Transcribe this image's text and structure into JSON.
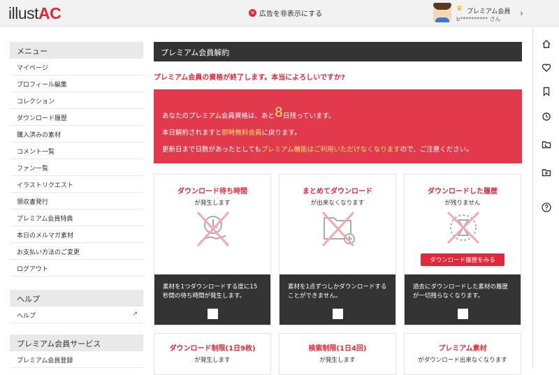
{
  "header": {
    "logo_part1": "illust",
    "logo_part2": "AC",
    "hide_ads": "広告を非表示にする",
    "user_label": "プレミアム会員",
    "user_name": "b********** さん"
  },
  "sidebar": {
    "menu_title": "メニュー",
    "menu_items": [
      "マイページ",
      "プロフィール編集",
      "コレクション",
      "ダウンロード履歴",
      "購入済みの素材",
      "コメント一覧",
      "ファン一覧",
      "イラストリクエスト",
      "領収書発行",
      "プレミアム会員特典",
      "本日のメルマガ素材",
      "お支払い方法のご変更",
      "ログアウト"
    ],
    "help_title": "ヘルプ",
    "help_item": "ヘルプ",
    "premium_title": "プレミアム会員サービス",
    "premium_item": "プレミアム会員登録"
  },
  "main": {
    "title": "プレミアム会員解約",
    "confirm": "プレミアム会員の資格が終了します。本当によろしいですか?",
    "alert": {
      "l1a": "あなたのプレミアム会員資格は、あと",
      "days": "8",
      "l1b": "日残っています。",
      "l2a": "本日解約されますと",
      "l2b": "即時無料会員",
      "l2c": "に戻ります。",
      "l3a": "更新日まで日数があったとしても",
      "l3b": "プレミアム機能はご利用いただけなくなります",
      "l3c": "ので、ご注意ください。"
    },
    "cards": [
      {
        "title": "ダウンロード待ち時間",
        "sub": "が発生します",
        "desc": "素材を1つダウンロードする度に15秒間の待ち時間が発生します。"
      },
      {
        "title": "まとめてダウンロード",
        "sub": "が出来なくなります",
        "desc": "素材を1点ずつしかダウンロードすることができません。"
      },
      {
        "title": "ダウンロードした履歴",
        "sub": "が残りません",
        "desc": "過去にダウンロードした素材の履歴が一切残らなくなります。",
        "button": "ダウンロード履歴をみる"
      }
    ],
    "cards2": [
      {
        "title": "ダウンロード制限(1日9枚)",
        "sub": "が発生します"
      },
      {
        "title": "検索制限(1日4回)",
        "sub": "が発生します"
      },
      {
        "title": "プレミアム素材",
        "sub": "がダウンロード出来なくなります"
      }
    ]
  },
  "rail": {
    "icons": [
      "home-icon",
      "heart-icon",
      "bookmark-icon",
      "history-icon",
      "download-folder-icon",
      "add-folder-icon",
      "help-icon"
    ]
  },
  "colors": {
    "accent": "#e0283a",
    "alert_bg": "#e03a4c",
    "highlight": "#ffe26a",
    "dark": "#333333"
  }
}
